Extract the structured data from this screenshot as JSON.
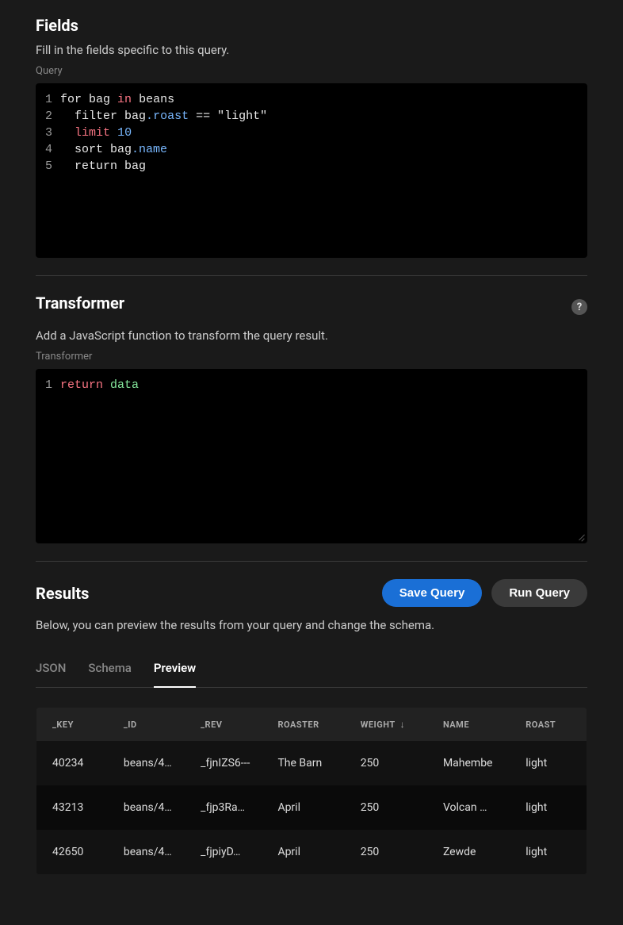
{
  "fields": {
    "title": "Fields",
    "desc": "Fill in the fields specific to this query.",
    "label": "Query",
    "code": [
      [
        {
          "t": "for",
          "c": "tok-ident"
        },
        {
          "t": " bag ",
          "c": "tok-ident"
        },
        {
          "t": "in",
          "c": "tok-kw"
        },
        {
          "t": " beans",
          "c": "tok-ident"
        }
      ],
      [
        {
          "t": "  filter bag",
          "c": "tok-ident"
        },
        {
          "t": ".",
          "c": "tok-op"
        },
        {
          "t": "roast",
          "c": "tok-prop"
        },
        {
          "t": " == ",
          "c": "tok-ident"
        },
        {
          "t": "\"light\"",
          "c": "tok-str"
        }
      ],
      [
        {
          "t": "  ",
          "c": "tok-ident"
        },
        {
          "t": "limit",
          "c": "tok-kw"
        },
        {
          "t": " ",
          "c": "tok-ident"
        },
        {
          "t": "10",
          "c": "tok-num"
        }
      ],
      [
        {
          "t": "  sort bag",
          "c": "tok-ident"
        },
        {
          "t": ".",
          "c": "tok-op"
        },
        {
          "t": "name",
          "c": "tok-prop"
        }
      ],
      [
        {
          "t": "  return bag",
          "c": "tok-ident"
        }
      ]
    ]
  },
  "transformer": {
    "title": "Transformer",
    "desc": "Add a JavaScript function to transform the query result.",
    "label": "Transformer",
    "code": [
      [
        {
          "t": "return",
          "c": "tok-kw"
        },
        {
          "t": " ",
          "c": "tok-ident"
        },
        {
          "t": "data",
          "c": "tok-green"
        }
      ]
    ]
  },
  "results": {
    "title": "Results",
    "save_label": "Save Query",
    "run_label": "Run Query",
    "desc": "Below, you can preview the results from your query and change the schema.",
    "tabs": [
      "JSON",
      "Schema",
      "Preview"
    ],
    "active_tab": 2,
    "sort_column": "WEIGHT",
    "columns": [
      "_KEY",
      "_ID",
      "_REV",
      "ROASTER",
      "WEIGHT",
      "NAME",
      "ROAST"
    ],
    "rows": [
      {
        "_KEY": "40234",
        "_ID": "beans/4…",
        "_REV": "_fjnIZS6---",
        "ROASTER": "The Barn",
        "WEIGHT": "250",
        "NAME": "Mahembe",
        "ROAST": "light"
      },
      {
        "_KEY": "43213",
        "_ID": "beans/4…",
        "_REV": "_fjp3Ra…",
        "ROASTER": "April",
        "WEIGHT": "250",
        "NAME": "Volcan …",
        "ROAST": "light"
      },
      {
        "_KEY": "42650",
        "_ID": "beans/4…",
        "_REV": "_fjpiyD…",
        "ROASTER": "April",
        "WEIGHT": "250",
        "NAME": "Zewde",
        "ROAST": "light"
      }
    ]
  }
}
